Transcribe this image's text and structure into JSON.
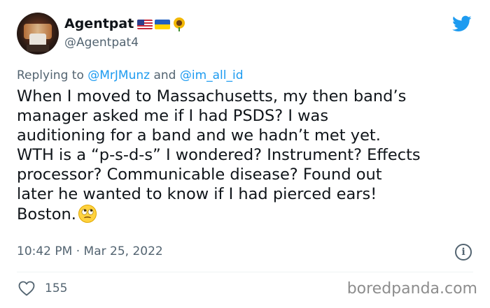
{
  "author": {
    "display_name": "Agentpat",
    "handle": "@Agentpat4",
    "badges": [
      "us-flag-icon",
      "ukraine-flag-icon",
      "sunflower-icon"
    ]
  },
  "reply": {
    "prefix": "Replying to",
    "mention_1": "@MrJMunz",
    "connector": "and",
    "mention_2": "@im_all_id"
  },
  "tweet": {
    "text": "When I moved to Massachusetts, my then band’s\nmanager asked me if I had PSDS? I was\nauditioning for a band and we hadn’t met yet.\nWTH is a “p-s-d-s” I wondered? Instrument? Effects\nprocessor? Communicable disease? Found out\nlater he wanted to know if I had pierced ears!\nBoston.",
    "emoji": "eye-roll-emoji"
  },
  "meta": {
    "timestamp": "10:42 PM · Mar 25, 2022",
    "info_icon": "info-icon"
  },
  "engagement": {
    "likes": "155"
  },
  "watermark": "boredpanda.com",
  "colors": {
    "text": "#0f1419",
    "secondary": "#536471",
    "link": "#1d9bf0",
    "twitter_blue": "#1d9bf0"
  }
}
